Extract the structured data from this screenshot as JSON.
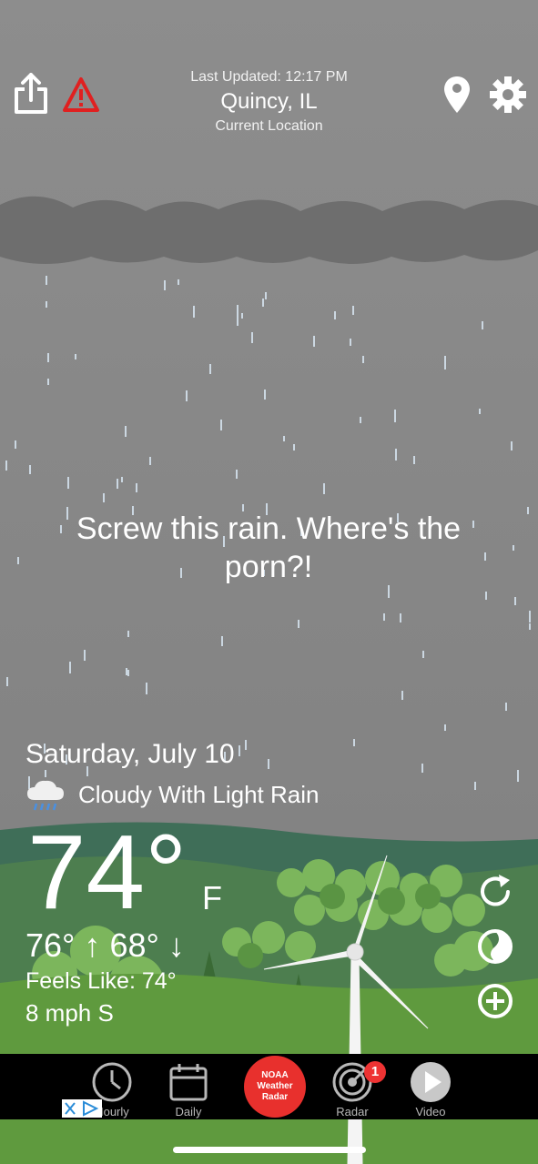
{
  "header": {
    "last_updated": "Last Updated: 12:17 PM",
    "city": "Quincy, IL",
    "location_label": "Current Location"
  },
  "quip": "Screw this rain. Where's the porn?!",
  "current": {
    "date": "Saturday, July 10",
    "condition": "Cloudy With Light Rain",
    "condition_icon": "rain-cloud-icon",
    "temperature": "74°",
    "unit": "F",
    "hi_lo": "76° ↑ 68° ↓",
    "feels_like": "Feels Like: 74°",
    "wind": "8 mph S"
  },
  "side_buttons": [
    "refresh-icon",
    "theme-icon",
    "add-icon"
  ],
  "nav": {
    "hourly": "Hourly",
    "daily": "Daily",
    "noaa_line1": "NOAA",
    "noaa_line2": "Weather",
    "noaa_line3": "Radar",
    "radar": "Radar",
    "radar_badge": "1",
    "video": "Video"
  },
  "colors": {
    "sky": "#8c8c8c",
    "cloud": "#6f6f6f",
    "grass": "#5a9a3a",
    "alert": "#e02020",
    "noaa": "#e8302d"
  }
}
